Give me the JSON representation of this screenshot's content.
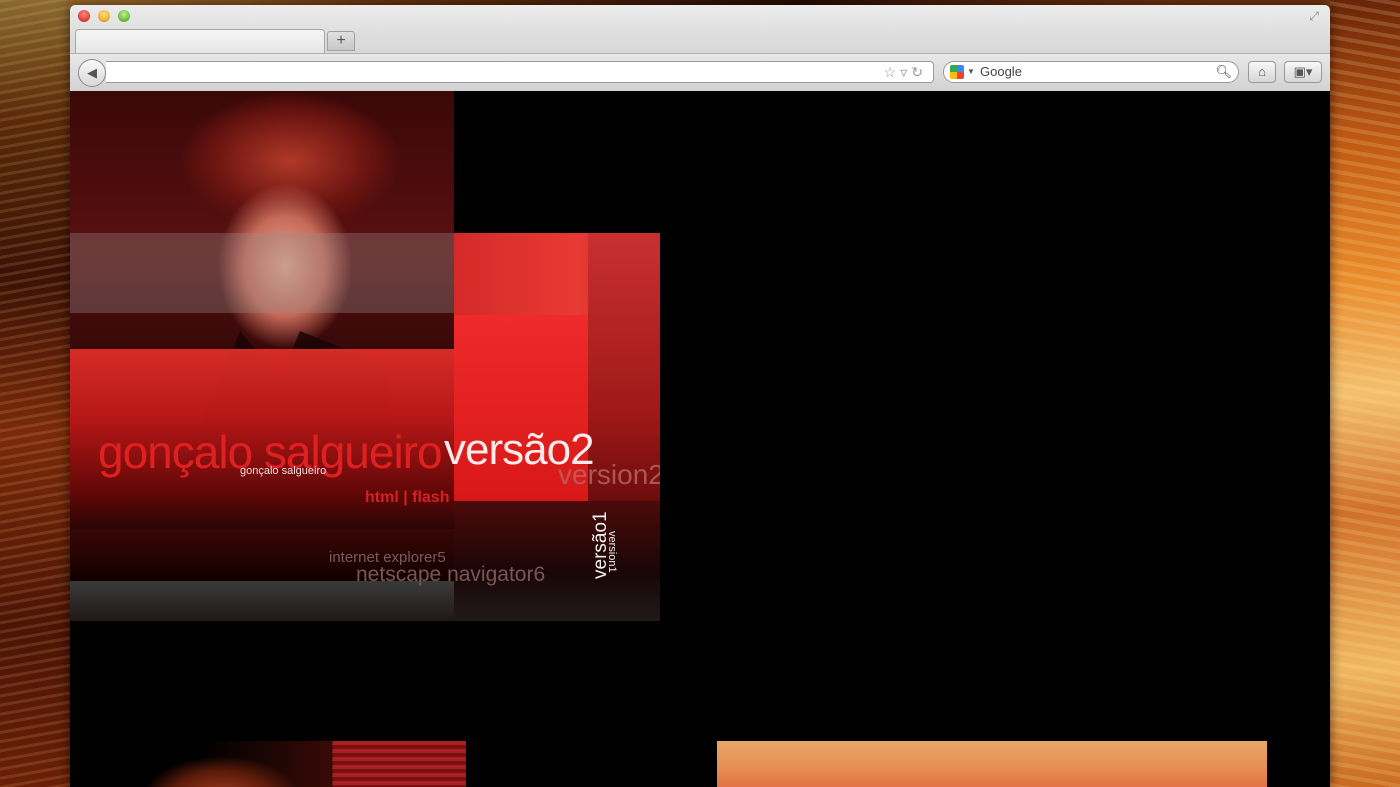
{
  "browser": {
    "tab_title": "",
    "new_tab_label": "+",
    "url": "",
    "search_placeholder": "Google",
    "icons": {
      "back": "back-arrow-icon",
      "star": "star-icon",
      "reload": "reload-icon",
      "search": "magnifier-icon",
      "home": "home-icon",
      "bookmarks": "bookmarks-icon",
      "fullscreen": "fullscreen-icon"
    }
  },
  "page": {
    "title": "gonçalo salgueiro",
    "title_small": "gonçalo salgueiro",
    "version2_pt": "versão2",
    "version2_en": "version2",
    "links": "html | flash",
    "browser_req_1": "internet explorer5",
    "browser_req_2": "netscape navigator6",
    "version1_pt": "versão1",
    "version1_en": "version1",
    "colors": {
      "accent_red": "#e02020",
      "background": "#000000",
      "text_light": "#fbeaea"
    }
  }
}
